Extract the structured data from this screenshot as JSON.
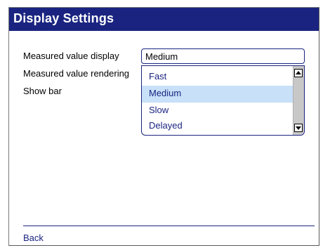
{
  "window": {
    "title": "Display Settings"
  },
  "settings": {
    "labels": [
      "Measured value display",
      "Measured value rendering",
      "Show bar"
    ]
  },
  "combo": {
    "value": "Medium",
    "options": [
      "Fast",
      "Medium",
      "Slow",
      "Delayed"
    ],
    "selected": "Medium"
  },
  "footer": {
    "back_label": "Back"
  },
  "colors": {
    "accent": "#1a2480",
    "selection": "#c8e0f8",
    "scrollbar": "#c8c8c8"
  }
}
